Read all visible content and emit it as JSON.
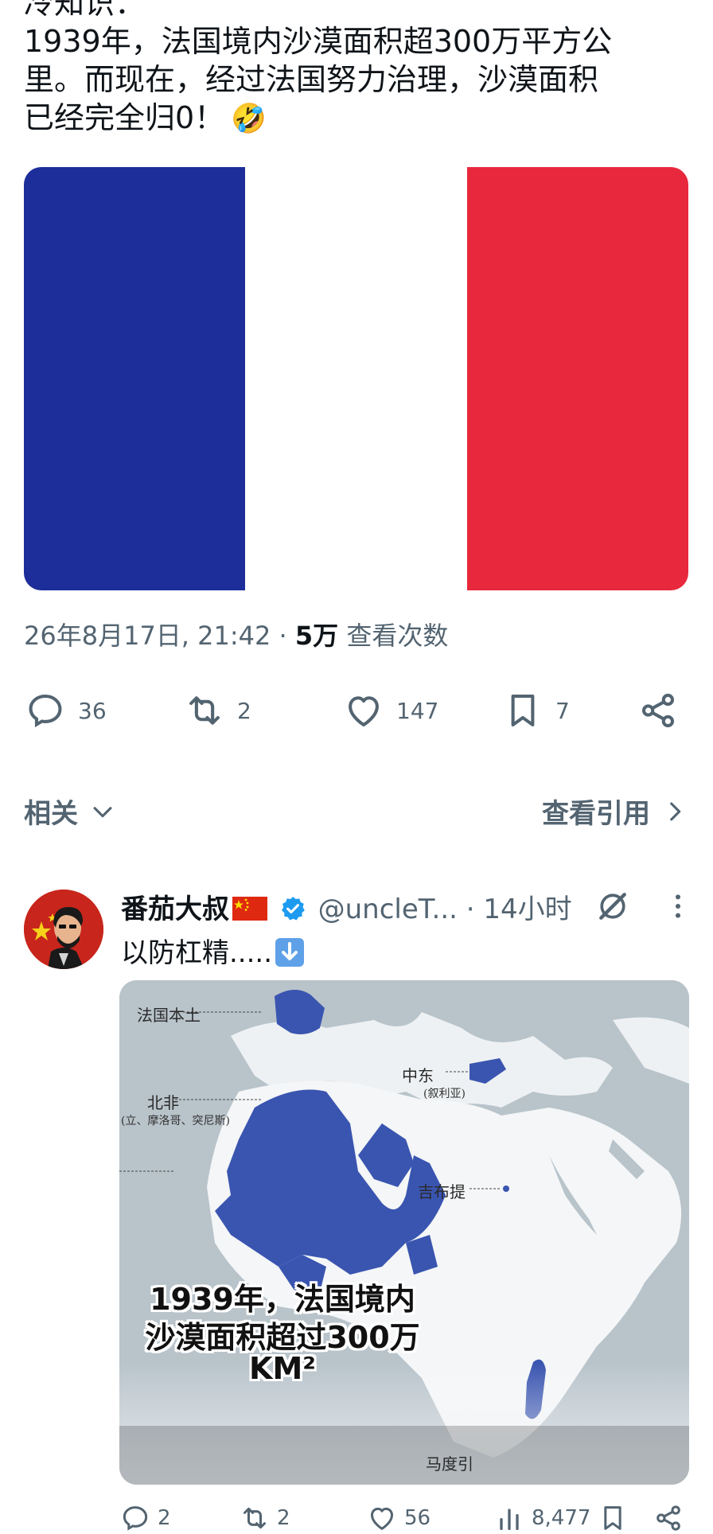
{
  "post": {
    "text_lines": [
      "冷知识：",
      "1939年，法国境内沙漠面积超300万平方公",
      "里。而现在，经过法国努力治理，沙漠面积",
      "已经完全归0！"
    ],
    "emoji": "🤣",
    "flag_colors": [
      "#1d2d99",
      "#ffffff",
      "#e8283c"
    ],
    "date": "26年8月17日, 21:42",
    "separator": "·",
    "views_count": "5万",
    "views_label": "查看次数"
  },
  "actions": {
    "reply_count": "36",
    "retweet_count": "2",
    "like_count": "147",
    "bookmark_count": "7"
  },
  "related": {
    "label": "相关",
    "view_quotes": "查看引用"
  },
  "quote_tweet": {
    "name": "番茄大叔",
    "handle": "@uncleT...",
    "time": "· 14小时",
    "text": "以防杠精.....",
    "map": {
      "labels": {
        "france": "法国本土",
        "north_africa": "北非",
        "north_africa_sub": "(立、摩洛哥、突尼斯)",
        "middle_east": "中东",
        "middle_east_sub": "(叙利亚)",
        "djibouti": "吉布提",
        "madagascar": "马度引"
      },
      "caption_lines": [
        "1939年，法国境内",
        "沙漠面积超过300万",
        "KM²"
      ]
    },
    "bottom_actions": {
      "reply_count": "2",
      "retweet_count": "2",
      "like_count": "56",
      "views_count": "8,477"
    }
  },
  "colors": {
    "text_primary": "#0f1419",
    "text_secondary": "#536471",
    "verified": "#1d9bf0",
    "map_blue": "#3a55b0"
  }
}
